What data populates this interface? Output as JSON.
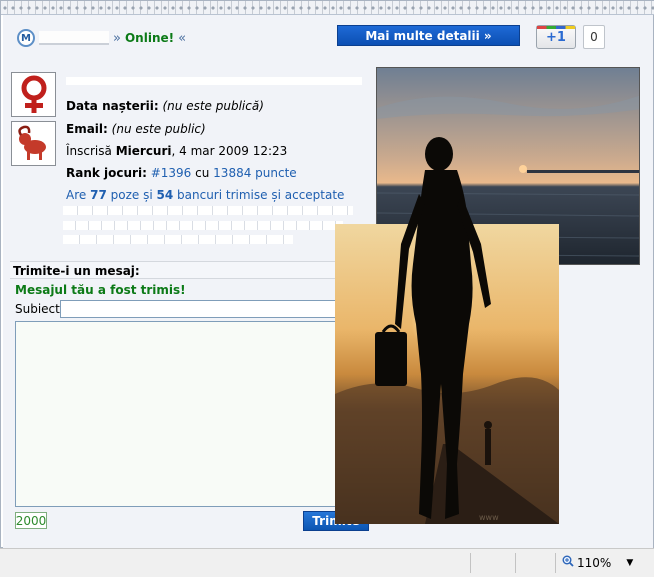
{
  "header": {
    "status": "Online!",
    "separator": "»",
    "back": "«",
    "more_button": "Mai multe detalii »",
    "plusone_label": "+1",
    "plusone_count": "0"
  },
  "profile": {
    "birth_label": "Data nașterii:",
    "birth_value": "(nu este publică)",
    "email_label": "Email:",
    "email_value": "(nu este public)",
    "joined_prefix": "Înscrisă",
    "joined_day": "Miercuri",
    "joined_date": ", 4 mar 2009 12:23",
    "rank_label": "Rank jocuri:",
    "rank_value": "#1396",
    "rank_mid": "cu",
    "rank_points": "13884 puncte",
    "stats_prefix": "Are",
    "photos_count": "77",
    "stats_mid": "poze și",
    "jokes_count": "54",
    "stats_suffix": "bancuri trimise și acceptate"
  },
  "message_form": {
    "title": "Trimite-i un mesaj:",
    "success": "Mesajul tău a fost trimis!",
    "subject_label": "Subiect",
    "subject_value": "",
    "body_value": "",
    "chars_left": "2000",
    "send_button": "Trimite"
  },
  "photo_watermark": "www",
  "statusbar": {
    "zoom": "110%"
  }
}
